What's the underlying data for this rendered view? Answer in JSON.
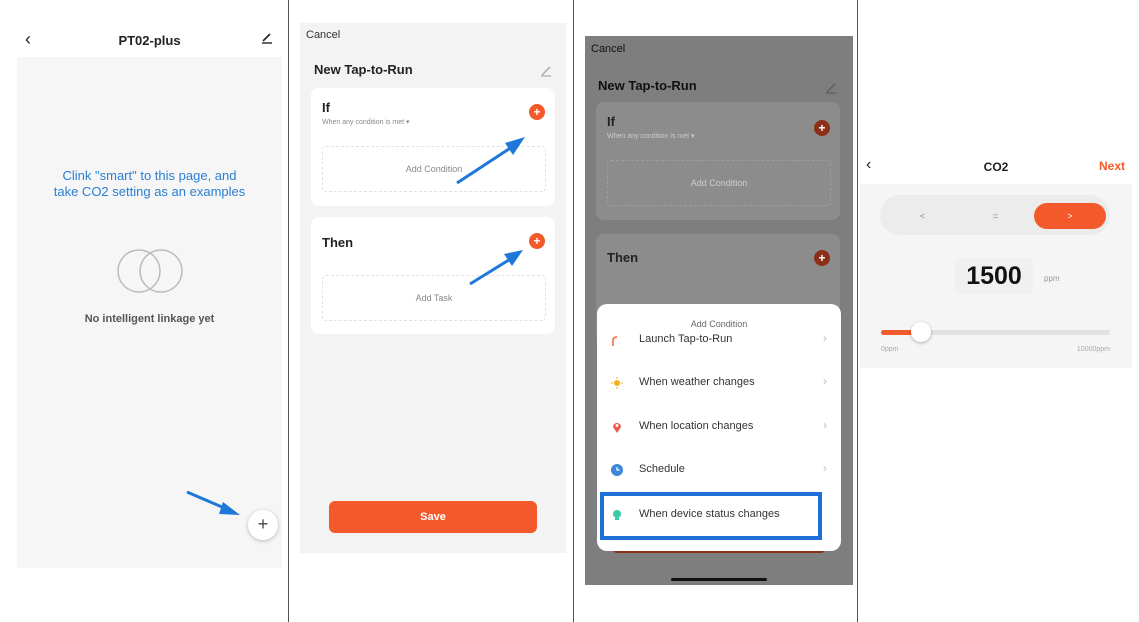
{
  "panel1": {
    "title": "PT02-plus",
    "back_icon": "‹",
    "edit_icon": "pencil-icon",
    "hint_line1": "Clink \"smart\" to this page, and",
    "hint_line2": "take CO2 setting as an examples",
    "empty_text": "No intelligent linkage yet",
    "add_icon": "+"
  },
  "panel2": {
    "cancel": "Cancel",
    "title": "New Tap-to-Run",
    "if_title": "If",
    "if_sub": "When any condition is met ▾",
    "add_condition": "Add Condition",
    "then_title": "Then",
    "add_task": "Add Task",
    "save": "Save"
  },
  "panel3": {
    "cancel": "Cancel",
    "title": "New Tap-to-Run",
    "if_title": "If",
    "if_sub": "When any condition is met ▾",
    "add_condition": "Add Condition",
    "then_title": "Then",
    "sheet_title": "Add Condition",
    "rows": [
      {
        "label": "Launch Tap-to-Run",
        "icon": "tap-icon",
        "color": "#f0662e"
      },
      {
        "label": "When weather changes",
        "icon": "sun-icon",
        "color": "#f3b21c"
      },
      {
        "label": "When location changes",
        "icon": "location-pin-icon",
        "color": "#ee5a4a"
      },
      {
        "label": "Schedule",
        "icon": "clock-icon",
        "color": "#3d86d9"
      },
      {
        "label": "When device status changes",
        "icon": "device-icon",
        "color": "#39c9a6"
      }
    ]
  },
  "panel4": {
    "title": "CO2",
    "next": "Next",
    "seg_less": "<",
    "seg_equal": "=",
    "seg_greater": ">",
    "value": "1500",
    "unit": "ppm",
    "range_min": "0ppm",
    "range_max": "10000ppm",
    "slider_fraction": 0.15
  },
  "colors": {
    "accent": "#f35a2b",
    "link_blue": "#2a7fd4",
    "highlight_blue": "#1e6fd6"
  }
}
